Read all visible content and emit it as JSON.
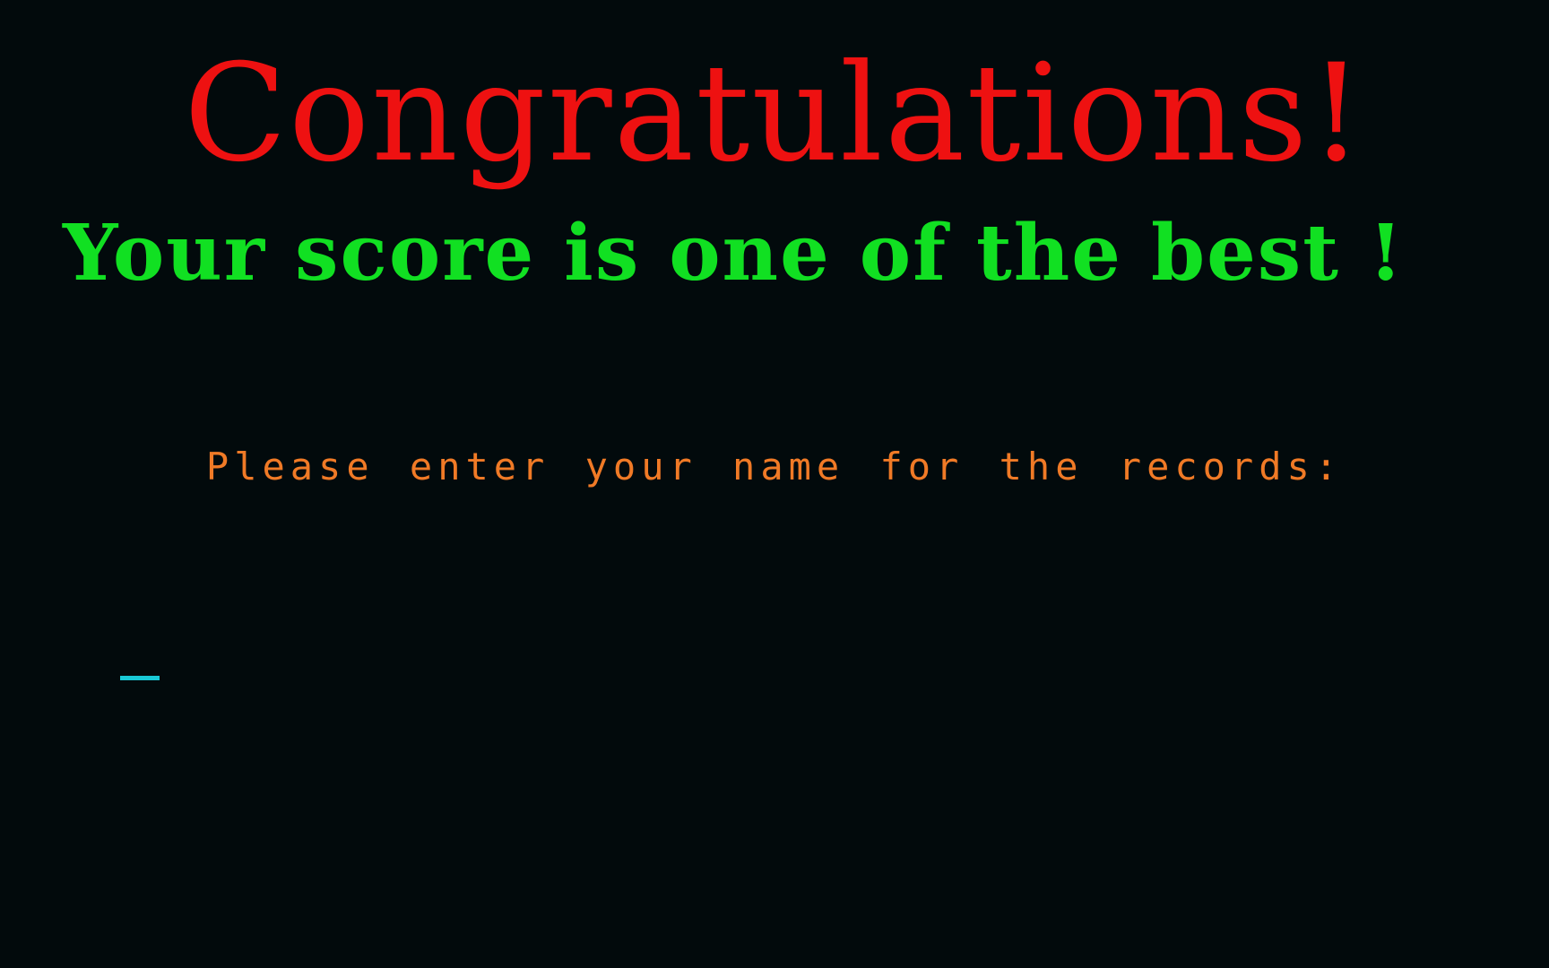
{
  "screen": {
    "title": "Congratulations!",
    "subtitle": "Your score is one of the best !",
    "prompt": "Please enter your name for the records:",
    "name_value": ""
  },
  "colors": {
    "background": "#020a0c",
    "title": "#ee1111",
    "subtitle": "#11e022",
    "prompt": "#f07a26",
    "cursor": "#19c9d6"
  }
}
